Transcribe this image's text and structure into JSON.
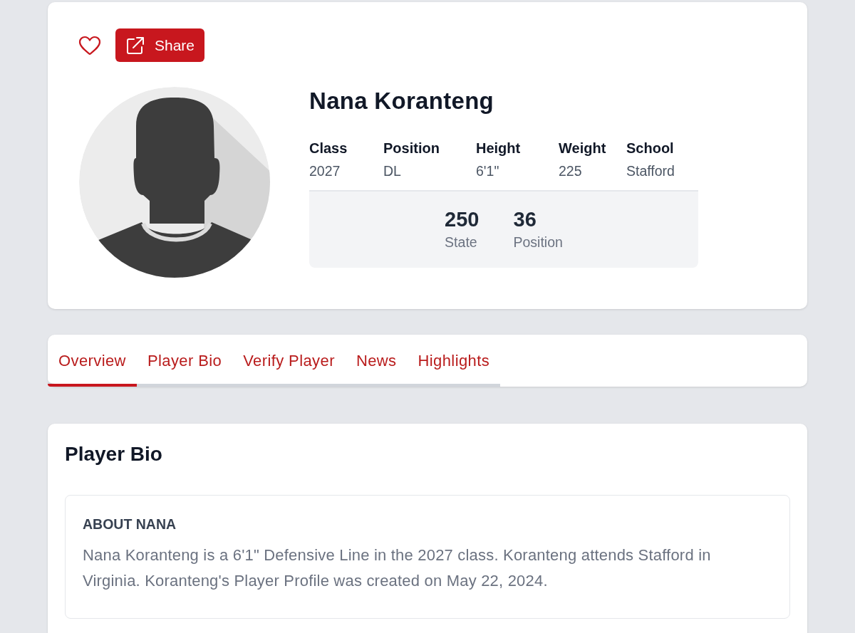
{
  "actions": {
    "favorite": {
      "on": false
    },
    "share": {
      "label": "Share"
    }
  },
  "player": {
    "name": "Nana Koranteng",
    "stats": [
      {
        "label": "Class",
        "value": "2027"
      },
      {
        "label": "Position",
        "value": "DL"
      },
      {
        "label": "Height",
        "value": "6'1\""
      },
      {
        "label": "Weight",
        "value": "225"
      },
      {
        "label": "School",
        "value": "Stafford"
      }
    ],
    "rankings": [
      {
        "value": "250",
        "label": "State"
      },
      {
        "value": "36",
        "label": "Position"
      }
    ]
  },
  "tabs": [
    {
      "label": "Overview",
      "selected": true
    },
    {
      "label": "Player Bio",
      "selected": false
    },
    {
      "label": "Verify Player",
      "selected": false
    },
    {
      "label": "News",
      "selected": false
    },
    {
      "label": "Highlights",
      "selected": false
    }
  ],
  "bio": {
    "title": "Player Bio",
    "heading": "ABOUT NANA",
    "text": "Nana Koranteng is a 6'1\" Defensive Line in the 2027 class. Koranteng attends Stafford in Virginia. Koranteng's Player Profile was created on May 22, 2024."
  }
}
